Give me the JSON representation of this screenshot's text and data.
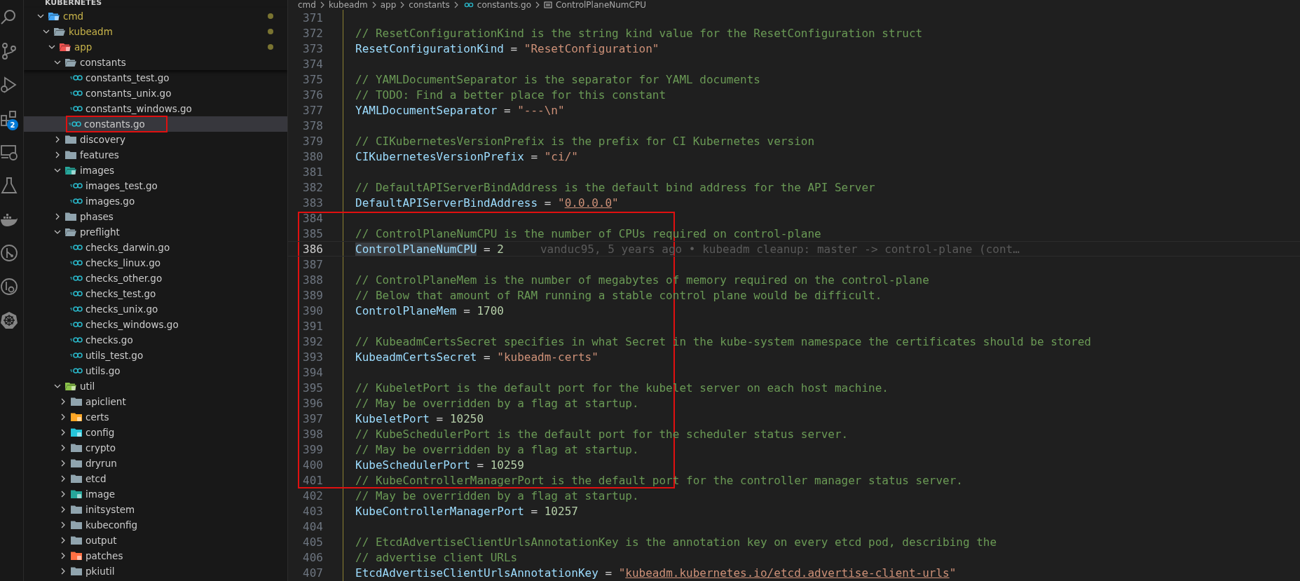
{
  "activity_bar": {
    "extensions_badge": "2"
  },
  "explorer": {
    "section_title": "KUBERNETES",
    "tree": [
      {
        "label": "cmd",
        "kind": "sourcefolder",
        "expanded": true,
        "modified": true,
        "selected": false,
        "boxed": false,
        "children": [
          {
            "label": "kubeadm",
            "kind": "folder",
            "expanded": true,
            "modified": true,
            "selected": false,
            "boxed": false,
            "children": [
              {
                "label": "app",
                "kind": "appfolder",
                "expanded": true,
                "modified": true,
                "selected": false,
                "boxed": false,
                "children": [
                  {
                    "label": "constants",
                    "kind": "libfolder",
                    "expanded": true,
                    "modified": false,
                    "selected": false,
                    "boxed": false,
                    "children": [
                      {
                        "label": "constants_test.go",
                        "kind": "gofile",
                        "modified": false,
                        "selected": false,
                        "boxed": false
                      },
                      {
                        "label": "constants_unix.go",
                        "kind": "gofile",
                        "modified": false,
                        "selected": false,
                        "boxed": false
                      },
                      {
                        "label": "constants_windows.go",
                        "kind": "gofile",
                        "modified": false,
                        "selected": false,
                        "boxed": false
                      },
                      {
                        "label": "constants.go",
                        "kind": "gofile",
                        "modified": false,
                        "selected": true,
                        "boxed": true
                      }
                    ]
                  },
                  {
                    "label": "discovery",
                    "kind": "folder",
                    "expanded": false,
                    "modified": false,
                    "selected": false,
                    "boxed": false
                  },
                  {
                    "label": "features",
                    "kind": "folder",
                    "expanded": false,
                    "modified": false,
                    "selected": false,
                    "boxed": false
                  },
                  {
                    "label": "images",
                    "kind": "imagefolder",
                    "expanded": true,
                    "modified": false,
                    "selected": false,
                    "boxed": false,
                    "children": [
                      {
                        "label": "images_test.go",
                        "kind": "gofile",
                        "modified": false,
                        "selected": false,
                        "boxed": false
                      },
                      {
                        "label": "images.go",
                        "kind": "gofile",
                        "modified": false,
                        "selected": false,
                        "boxed": false
                      }
                    ]
                  },
                  {
                    "label": "phases",
                    "kind": "folder",
                    "expanded": false,
                    "modified": false,
                    "selected": false,
                    "boxed": false
                  },
                  {
                    "label": "preflight",
                    "kind": "folder",
                    "expanded": true,
                    "modified": false,
                    "selected": false,
                    "boxed": false,
                    "children": [
                      {
                        "label": "checks_darwin.go",
                        "kind": "gofile",
                        "modified": false,
                        "selected": false,
                        "boxed": false
                      },
                      {
                        "label": "checks_linux.go",
                        "kind": "gofile",
                        "modified": false,
                        "selected": false,
                        "boxed": false
                      },
                      {
                        "label": "checks_other.go",
                        "kind": "gofile",
                        "modified": false,
                        "selected": false,
                        "boxed": false
                      },
                      {
                        "label": "checks_test.go",
                        "kind": "gofile",
                        "modified": false,
                        "selected": false,
                        "boxed": false
                      },
                      {
                        "label": "checks_unix.go",
                        "kind": "gofile",
                        "modified": false,
                        "selected": false,
                        "boxed": false
                      },
                      {
                        "label": "checks_windows.go",
                        "kind": "gofile",
                        "modified": false,
                        "selected": false,
                        "boxed": false
                      },
                      {
                        "label": "checks.go",
                        "kind": "gofile",
                        "modified": false,
                        "selected": false,
                        "boxed": false
                      },
                      {
                        "label": "utils_test.go",
                        "kind": "gofile",
                        "modified": false,
                        "selected": false,
                        "boxed": false
                      },
                      {
                        "label": "utils.go",
                        "kind": "gofile",
                        "modified": false,
                        "selected": false,
                        "boxed": false
                      }
                    ]
                  },
                  {
                    "label": "util",
                    "kind": "utilfolder",
                    "expanded": true,
                    "modified": false,
                    "selected": false,
                    "boxed": false,
                    "children": [
                      {
                        "label": "apiclient",
                        "kind": "folder",
                        "expanded": false,
                        "modified": false,
                        "selected": false,
                        "boxed": false
                      },
                      {
                        "label": "certs",
                        "kind": "certfolder",
                        "expanded": false,
                        "modified": false,
                        "selected": false,
                        "boxed": false
                      },
                      {
                        "label": "config",
                        "kind": "configfolder",
                        "expanded": false,
                        "modified": false,
                        "selected": false,
                        "boxed": false
                      },
                      {
                        "label": "crypto",
                        "kind": "folder",
                        "expanded": false,
                        "modified": false,
                        "selected": false,
                        "boxed": false
                      },
                      {
                        "label": "dryrun",
                        "kind": "folder",
                        "expanded": false,
                        "modified": false,
                        "selected": false,
                        "boxed": false
                      },
                      {
                        "label": "etcd",
                        "kind": "folder",
                        "expanded": false,
                        "modified": false,
                        "selected": false,
                        "boxed": false
                      },
                      {
                        "label": "image",
                        "kind": "imagefolder",
                        "expanded": false,
                        "modified": false,
                        "selected": false,
                        "boxed": false
                      },
                      {
                        "label": "initsystem",
                        "kind": "folder",
                        "expanded": false,
                        "modified": false,
                        "selected": false,
                        "boxed": false
                      },
                      {
                        "label": "kubeconfig",
                        "kind": "folder",
                        "expanded": false,
                        "modified": false,
                        "selected": false,
                        "boxed": false
                      },
                      {
                        "label": "output",
                        "kind": "folder",
                        "expanded": false,
                        "modified": false,
                        "selected": false,
                        "boxed": false
                      },
                      {
                        "label": "patches",
                        "kind": "patchfolder",
                        "expanded": false,
                        "modified": false,
                        "selected": false,
                        "boxed": false
                      },
                      {
                        "label": "pkiutil",
                        "kind": "folder",
                        "expanded": false,
                        "modified": false,
                        "selected": false,
                        "boxed": false
                      }
                    ]
                  }
                ]
              }
            ]
          }
        ]
      }
    ]
  },
  "breadcrumb": [
    {
      "label": "cmd",
      "kind": "folder"
    },
    {
      "label": "kubeadm",
      "kind": "folder"
    },
    {
      "label": "app",
      "kind": "folder"
    },
    {
      "label": "constants",
      "kind": "folder"
    },
    {
      "label": "constants.go",
      "kind": "gofile"
    },
    {
      "label": "ControlPlaneNumCPU",
      "kind": "symbol"
    }
  ],
  "editor": {
    "blocks": [
      {
        "boxed": false,
        "lines": [
          {
            "number": "371",
            "current": false
          },
          {
            "number": "372",
            "current": false,
            "tokens": [
              {
                "kind": "comment",
                "text": "// ResetConfigurationKind is the string kind value for the ResetConfiguration struct"
              }
            ]
          },
          {
            "number": "373",
            "current": false,
            "tokens": [
              {
                "kind": "name",
                "text": "ResetConfigurationKind"
              },
              {
                "kind": "op",
                "text": " = "
              },
              {
                "kind": "string",
                "text": "\"ResetConfiguration\""
              }
            ]
          },
          {
            "number": "374",
            "current": false
          },
          {
            "number": "375",
            "current": false,
            "tokens": [
              {
                "kind": "comment",
                "text": "// YAMLDocumentSeparator is the separator for YAML documents"
              }
            ]
          },
          {
            "number": "376",
            "current": false,
            "tokens": [
              {
                "kind": "comment",
                "text": "// TODO: Find a better place for this constant"
              }
            ]
          },
          {
            "number": "377",
            "current": false,
            "tokens": [
              {
                "kind": "name",
                "text": "YAMLDocumentSeparator"
              },
              {
                "kind": "op",
                "text": " = "
              },
              {
                "kind": "string",
                "text": "\"---\\n\""
              }
            ]
          },
          {
            "number": "378",
            "current": false
          },
          {
            "number": "379",
            "current": false,
            "tokens": [
              {
                "kind": "comment",
                "text": "// CIKubernetesVersionPrefix is the prefix for CI Kubernetes version"
              }
            ]
          },
          {
            "number": "380",
            "current": false,
            "tokens": [
              {
                "kind": "name",
                "text": "CIKubernetesVersionPrefix"
              },
              {
                "kind": "op",
                "text": " = "
              },
              {
                "kind": "string",
                "text": "\"ci/\""
              }
            ]
          },
          {
            "number": "381",
            "current": false
          },
          {
            "number": "382",
            "current": false,
            "tokens": [
              {
                "kind": "comment",
                "text": "// DefaultAPIServerBindAddress is the default bind address for the API Server"
              }
            ]
          },
          {
            "number": "383",
            "current": false,
            "tokens": [
              {
                "kind": "name",
                "text": "DefaultAPIServerBindAddress"
              },
              {
                "kind": "op",
                "text": " = "
              },
              {
                "kind": "string",
                "text": "\""
              },
              {
                "kind": "link",
                "text": "0.0.0.0"
              },
              {
                "kind": "string",
                "text": "\""
              }
            ]
          }
        ]
      },
      {
        "boxed": true,
        "lines": [
          {
            "number": "384",
            "current": false
          },
          {
            "number": "385",
            "current": false,
            "tokens": [
              {
                "kind": "comment",
                "text": "// ControlPlaneNumCPU is the number of CPUs required on control-plane"
              }
            ]
          },
          {
            "number": "386",
            "current": true,
            "tokens": [
              {
                "kind": "selectedname",
                "text": "ControlPlaneNumCPU"
              },
              {
                "kind": "op",
                "text": " = "
              },
              {
                "kind": "number",
                "text": "2"
              }
            ],
            "blame": "vanduc95, 5 years ago • kubeadm cleanup: master -> control-plane (cont…"
          },
          {
            "number": "387",
            "current": false
          },
          {
            "number": "388",
            "current": false,
            "tokens": [
              {
                "kind": "comment",
                "text": "// ControlPlaneMem is the number of megabytes of memory required on the control-plane"
              }
            ]
          },
          {
            "number": "389",
            "current": false,
            "tokens": [
              {
                "kind": "comment",
                "text": "// Below that amount of RAM running a stable control plane would be difficult."
              }
            ]
          },
          {
            "number": "390",
            "current": false,
            "tokens": [
              {
                "kind": "name",
                "text": "ControlPlaneMem"
              },
              {
                "kind": "op",
                "text": " = "
              },
              {
                "kind": "number",
                "text": "1700"
              }
            ]
          },
          {
            "number": "391",
            "current": false
          },
          {
            "number": "392",
            "current": false,
            "tokens": [
              {
                "kind": "comment",
                "text": "// KubeadmCertsSecret specifies in what Secret in the kube-system namespace the certificates should be stored"
              }
            ]
          },
          {
            "number": "393",
            "current": false,
            "tokens": [
              {
                "kind": "name",
                "text": "KubeadmCertsSecret"
              },
              {
                "kind": "op",
                "text": " = "
              },
              {
                "kind": "string",
                "text": "\"kubeadm-certs\""
              }
            ]
          },
          {
            "number": "394",
            "current": false
          },
          {
            "number": "395",
            "current": false,
            "tokens": [
              {
                "kind": "comment",
                "text": "// KubeletPort is the default port for the kubelet server on each host machine."
              }
            ]
          },
          {
            "number": "396",
            "current": false,
            "tokens": [
              {
                "kind": "comment",
                "text": "// May be overridden by a flag at startup."
              }
            ]
          },
          {
            "number": "397",
            "current": false,
            "tokens": [
              {
                "kind": "name",
                "text": "KubeletPort"
              },
              {
                "kind": "op",
                "text": " = "
              },
              {
                "kind": "number",
                "text": "10250"
              }
            ]
          },
          {
            "number": "398",
            "current": false,
            "tokens": [
              {
                "kind": "comment",
                "text": "// KubeSchedulerPort is the default port for the scheduler status server."
              }
            ]
          },
          {
            "number": "399",
            "current": false,
            "tokens": [
              {
                "kind": "comment",
                "text": "// May be overridden by a flag at startup."
              }
            ]
          },
          {
            "number": "400",
            "current": false,
            "tokens": [
              {
                "kind": "name",
                "text": "KubeSchedulerPort"
              },
              {
                "kind": "op",
                "text": " = "
              },
              {
                "kind": "number",
                "text": "10259"
              }
            ]
          },
          {
            "number": "401",
            "current": false,
            "tokens": [
              {
                "kind": "comment",
                "text": "// KubeControllerManagerPort is the default port for the controller manager status server."
              }
            ]
          }
        ]
      },
      {
        "boxed": false,
        "lines": [
          {
            "number": "402",
            "current": false,
            "tokens": [
              {
                "kind": "comment",
                "text": "// May be overridden by a flag at startup."
              }
            ]
          },
          {
            "number": "403",
            "current": false,
            "tokens": [
              {
                "kind": "name",
                "text": "KubeControllerManagerPort"
              },
              {
                "kind": "op",
                "text": " = "
              },
              {
                "kind": "number",
                "text": "10257"
              }
            ]
          },
          {
            "number": "404",
            "current": false
          },
          {
            "number": "405",
            "current": false,
            "tokens": [
              {
                "kind": "comment",
                "text": "// EtcdAdvertiseClientUrlsAnnotationKey is the annotation key on every etcd pod, describing the"
              }
            ]
          },
          {
            "number": "406",
            "current": false,
            "tokens": [
              {
                "kind": "comment",
                "text": "// advertise client URLs"
              }
            ]
          },
          {
            "number": "407",
            "current": false,
            "tokens": [
              {
                "kind": "name",
                "text": "EtcdAdvertiseClientUrlsAnnotationKey"
              },
              {
                "kind": "op",
                "text": " = "
              },
              {
                "kind": "string",
                "text": "\""
              },
              {
                "kind": "link",
                "text": "kubeadm.kubernetes.io/etcd.advertise-client-urls"
              },
              {
                "kind": "string",
                "text": "\""
              }
            ]
          }
        ]
      }
    ]
  }
}
